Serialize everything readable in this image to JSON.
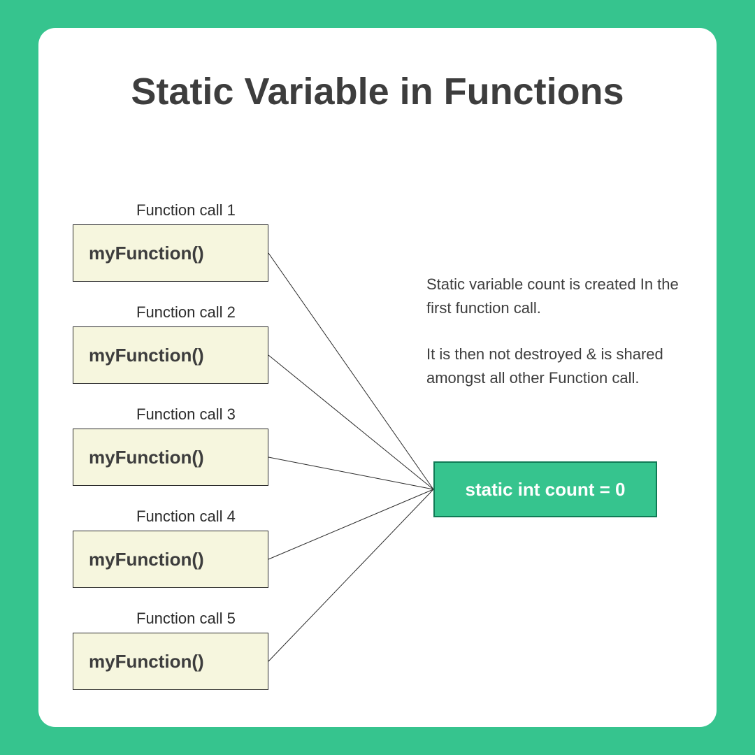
{
  "title": "Static Variable in Functions",
  "function_calls": [
    {
      "label": "Function call 1",
      "text": "myFunction()"
    },
    {
      "label": "Function call 2",
      "text": "myFunction()"
    },
    {
      "label": "Function call 3",
      "text": "myFunction()"
    },
    {
      "label": "Function call 4",
      "text": "myFunction()"
    },
    {
      "label": "Function call 5",
      "text": "myFunction()"
    }
  ],
  "static_box": "static int count = 0",
  "description": {
    "p1": "Static variable count is created In the first function call.",
    "p2": "It is then not destroyed & is shared amongst all other Function call."
  },
  "colors": {
    "background": "#36c48e",
    "card": "#ffffff",
    "fn_box_bg": "#f6f6de",
    "fn_box_border": "#2b2b2b",
    "static_box_bg": "#36c48e",
    "static_box_border": "#0f7a55",
    "text": "#3d3d3d"
  }
}
